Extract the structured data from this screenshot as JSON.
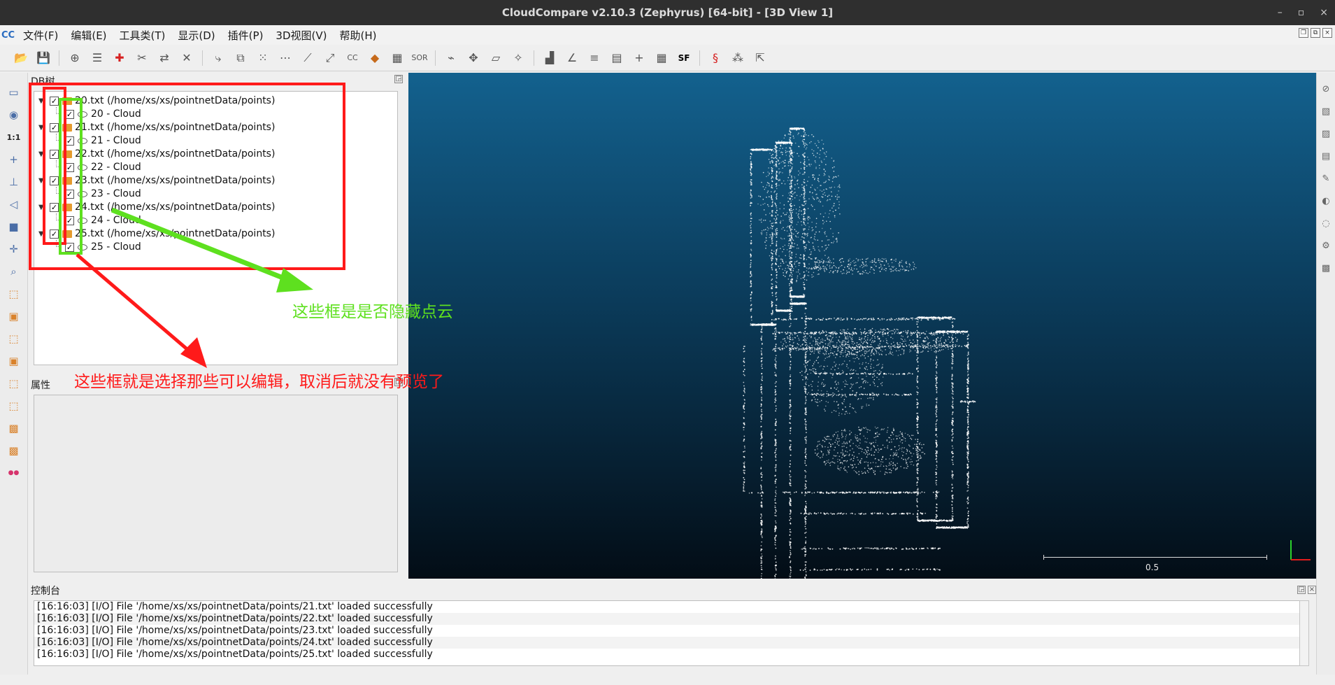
{
  "window": {
    "title": "CloudCompare v2.10.3 (Zephyrus) [64-bit] - [3D View 1]",
    "minimize": "–",
    "maximize": "▫",
    "close": "×"
  },
  "menu": {
    "app_icon": "CC",
    "items": [
      "文件(F)",
      "编辑(E)",
      "工具类(T)",
      "显示(D)",
      "插件(P)",
      "3D视图(V)",
      "帮助(H)"
    ]
  },
  "panels": {
    "db_tree_title": "DB树",
    "properties_title": "属性",
    "console_title": "控制台"
  },
  "tree": {
    "entries": [
      {
        "file": "20.txt (/home/xs/xs/pointnetData/points)",
        "cloud": "20 - Cloud"
      },
      {
        "file": "21.txt (/home/xs/xs/pointnetData/points)",
        "cloud": "21 - Cloud"
      },
      {
        "file": "22.txt (/home/xs/xs/pointnetData/points)",
        "cloud": "22 - Cloud"
      },
      {
        "file": "23.txt (/home/xs/xs/pointnetData/points)",
        "cloud": "23 - Cloud"
      },
      {
        "file": "24.txt (/home/xs/xs/pointnetData/points)",
        "cloud": "24 - Cloud"
      },
      {
        "file": "25.txt (/home/xs/xs/pointnetData/points)",
        "cloud": "25 - Cloud"
      }
    ]
  },
  "view": {
    "scale_label": "0.5"
  },
  "console": {
    "lines": [
      "[16:16:03] [I/O] File '/home/xs/xs/pointnetData/points/21.txt' loaded successfully",
      "[16:16:03] [I/O] File '/home/xs/xs/pointnetData/points/22.txt' loaded successfully",
      "[16:16:03] [I/O] File '/home/xs/xs/pointnetData/points/23.txt' loaded successfully",
      "[16:16:03] [I/O] File '/home/xs/xs/pointnetData/points/24.txt' loaded successfully",
      "[16:16:03] [I/O] File '/home/xs/xs/pointnetData/points/25.txt' loaded successfully"
    ]
  },
  "annotations": {
    "green_text": "这些框是是否隐藏点云",
    "red_text": "这些框就是选择那些可以编辑，取消后就没有预览了"
  },
  "colors": {
    "annotation_red": "#ff1a1a",
    "annotation_green": "#5ee01f",
    "view_top": "#13618e",
    "view_bottom": "#030d16",
    "folder": "#e59b2d"
  },
  "toolbar_icons": [
    "open-icon",
    "save-icon",
    "sep",
    "transform-icon",
    "list-icon",
    "add-point-icon",
    "segment-icon",
    "translate-icon",
    "delete-icon",
    "sep",
    "merge-icon",
    "clone-icon",
    "sample-icon",
    "subsample-icon",
    "sf-icon",
    "register-icon",
    "cc-icon",
    "bucket-icon",
    "checker-icon",
    "sor-icon",
    "sep",
    "measure-icon",
    "move-icon",
    "plane-icon",
    "pick-icon",
    "sep",
    "histogram-icon",
    "slope-icon",
    "minmax-icon",
    "calendar-icon",
    "plus-icon",
    "calculator-icon",
    "sf-color-icon",
    "sep",
    "compass-icon",
    "noise-icon",
    "export-icon"
  ],
  "left_toolbar_icons": [
    "monitor-icon",
    "camera-icon",
    "one-to-one-icon",
    "plus-icon",
    "auto-pivot-icon",
    "rotate-icon",
    "box-icon",
    "move-cross-icon",
    "zoom-icon",
    "front-cube-icon",
    "top-cube-icon",
    "left-cube-icon",
    "back-cube-icon",
    "right-cube-icon",
    "bottom-cube-icon",
    "front-label-icon",
    "back-label-icon",
    "stereo-icon"
  ],
  "right_toolbar_icons": [
    "hide-icon",
    "scalar-icon",
    "display-icon",
    "film-icon",
    "brush-icon",
    "sf-glyph-icon",
    "hpr-icon",
    "misc-icon",
    "pdf-icon"
  ]
}
